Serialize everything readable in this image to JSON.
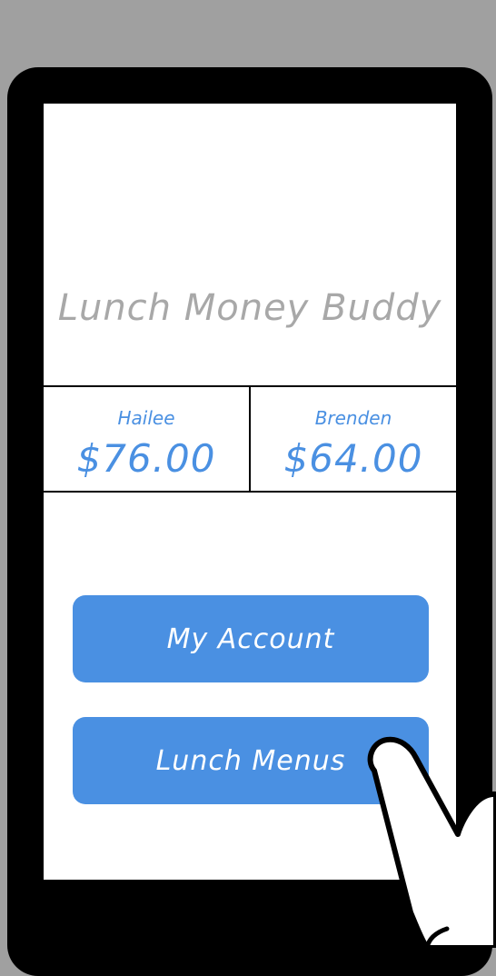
{
  "app": {
    "title": "Lunch Money Buddy"
  },
  "balances": [
    {
      "name": "Hailee",
      "amount": "$76.00"
    },
    {
      "name": "Brenden",
      "amount": "$64.00"
    }
  ],
  "buttons": {
    "my_account": "My Account",
    "lunch_menus": "Lunch Menus"
  },
  "colors": {
    "accent": "#4a90e2",
    "title_gray": "#a8a8a8",
    "frame": "#000000",
    "backdrop": "#a0a0a0"
  },
  "icons": {
    "pointer": "hand-pointer-icon"
  }
}
